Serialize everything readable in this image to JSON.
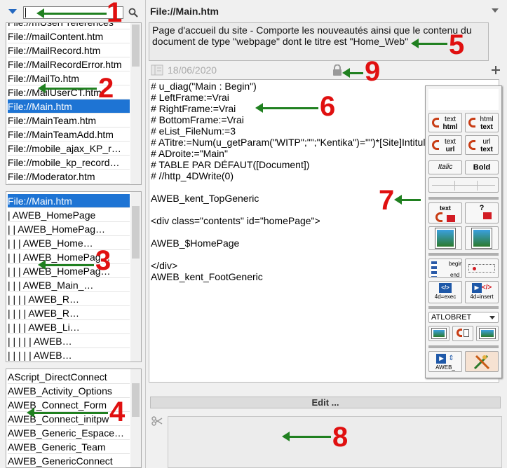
{
  "file_list": [
    "File://mUserPreferences",
    "File://mailContent.htm",
    "File://MailRecord.htm",
    "File://MailRecordError.htm",
    "File://MailTo.htm",
    "File://MailUserCT.htm",
    "File://Main.htm",
    "File://MainTeam.htm",
    "File://MainTeamAdd.htm",
    "File://mobile_ajax_KP_r…",
    "File://mobile_kp_record…",
    "File://Moderator.htm"
  ],
  "tree_list": [
    "File://Main.htm",
    "|    AWEB_HomePage",
    "|    |    AWEB_HomePag…",
    "|    |    |    AWEB_Home…",
    "|    |    |    AWEB_HomePag…",
    "|    |    |    AWEB_HomePag…",
    "|    |    |    AWEB_Main_…",
    "|    |    |    |    AWEB_R…",
    "|    |    |    |    AWEB_R…",
    "|    |    |    |    AWEB_Li…",
    "|    |    |    |    |    AWEB…",
    "|    |    |    |    |    AWEB…"
  ],
  "method_list": [
    "AScript_DirectConnect",
    "AWEB_Activity_Options",
    "AWEB_Connect_Form",
    "AWEB_Connect_initpw",
    "AWEB_Generic_Espace…",
    "AWEB_Generic_Team",
    "AWEB_GenericConnect"
  ],
  "file_title": "File://Main.htm",
  "description": "Page d'accueil du site - Comporte les nouveautés ainsi que le contenu du document de type \"webpage\" dont le titre est \"Home_Web\"",
  "date": "18/06/2020",
  "code_lines": [
    "# u_diag(\"Main : Begin\")",
    "# LeftFrame:=Vrai",
    "# RightFrame:=Vrai",
    "# BottomFrame:=Vrai",
    "# eList_FileNum:=3",
    "# ATitre:=Num(u_getParam(\"WITP\";\"\";\"Kentika\")=\"\")*[Site]Intitulé",
    "# ADroite:=\"Main\"",
    "# TABLE PAR DÉFAUT([Document])",
    "# //http_4DWrite(0)",
    "",
    "AWEB_kent_TopGeneric",
    "",
    "<div class=\"contents\" id=\"homePage\">",
    "",
    "AWEB_$HomePage",
    "",
    "</div>",
    "AWEB_kent_FootGeneric"
  ],
  "edit_label": "Edit ...",
  "palette": {
    "text_html": [
      "text",
      "html"
    ],
    "html_text": [
      "html",
      "text"
    ],
    "text_url": [
      "text",
      "url"
    ],
    "url_text": [
      "url",
      "text"
    ],
    "italic": "Italic",
    "bold": "Bold",
    "text_flag": "text",
    "question_flag": "?",
    "begin": "begin",
    "end": "end",
    "exec": "4d=exec",
    "insert": "4d=insert",
    "dropdown": "ATLOBRET",
    "aweb": "AWEB_"
  },
  "annotations": [
    "1",
    "2",
    "3",
    "4",
    "5",
    "6",
    "7",
    "8",
    "9"
  ],
  "colors": {
    "selection": "#1e74d4",
    "annotation": "#e01010",
    "arrow": "#208020"
  }
}
